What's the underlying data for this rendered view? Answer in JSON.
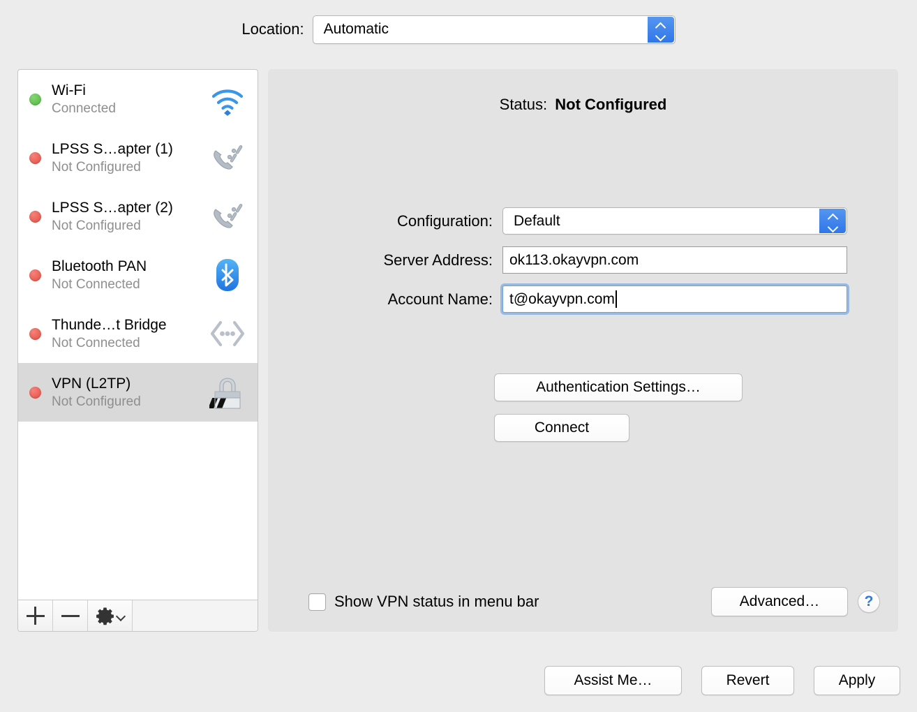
{
  "location": {
    "label": "Location:",
    "value": "Automatic",
    "stepper_color": "#2f76e8"
  },
  "sidebar": {
    "services": [
      {
        "name": "Wi-Fi",
        "status": "Connected",
        "dot": "green",
        "dot_color": "#4fb63c",
        "icon": "wifi-icon"
      },
      {
        "name": "LPSS S…apter (1)",
        "status": "Not Configured",
        "dot": "red",
        "dot_color": "#e24c42",
        "icon": "modem-phone-icon"
      },
      {
        "name": "LPSS S…apter (2)",
        "status": "Not Configured",
        "dot": "red",
        "dot_color": "#e24c42",
        "icon": "modem-phone-icon"
      },
      {
        "name": "Bluetooth PAN",
        "status": "Not Connected",
        "dot": "red",
        "dot_color": "#e24c42",
        "icon": "bluetooth-icon"
      },
      {
        "name": "Thunde…t Bridge",
        "status": "Not Connected",
        "dot": "red",
        "dot_color": "#e24c42",
        "icon": "thunderbolt-bridge-icon"
      },
      {
        "name": "VPN (L2TP)",
        "status": "Not Configured",
        "dot": "red",
        "dot_color": "#e24c42",
        "icon": "padlock-icon",
        "selected": true
      }
    ],
    "toolbar": {
      "add": "plus-icon",
      "remove": "minus-icon",
      "action": "gear-icon",
      "action_chevron": "chevron-down-icon"
    }
  },
  "detail": {
    "status_label": "Status:",
    "status_value": "Not Configured",
    "fields": [
      {
        "label": "Configuration:",
        "value": "Default",
        "type": "popup"
      },
      {
        "label": "Server Address:",
        "value": "ok113.okayvpn.com",
        "type": "text"
      },
      {
        "label": "Account Name:",
        "value": "t@okayvpn.com",
        "type": "text",
        "focused": true
      }
    ],
    "auth_button": "Authentication Settings…",
    "connect_button": "Connect",
    "show_status_checkbox": {
      "label": "Show VPN status in menu bar",
      "checked": false
    },
    "advanced_button": "Advanced…",
    "help_button": "?"
  },
  "footer": {
    "assist": "Assist Me…",
    "revert": "Revert",
    "apply": "Apply"
  }
}
